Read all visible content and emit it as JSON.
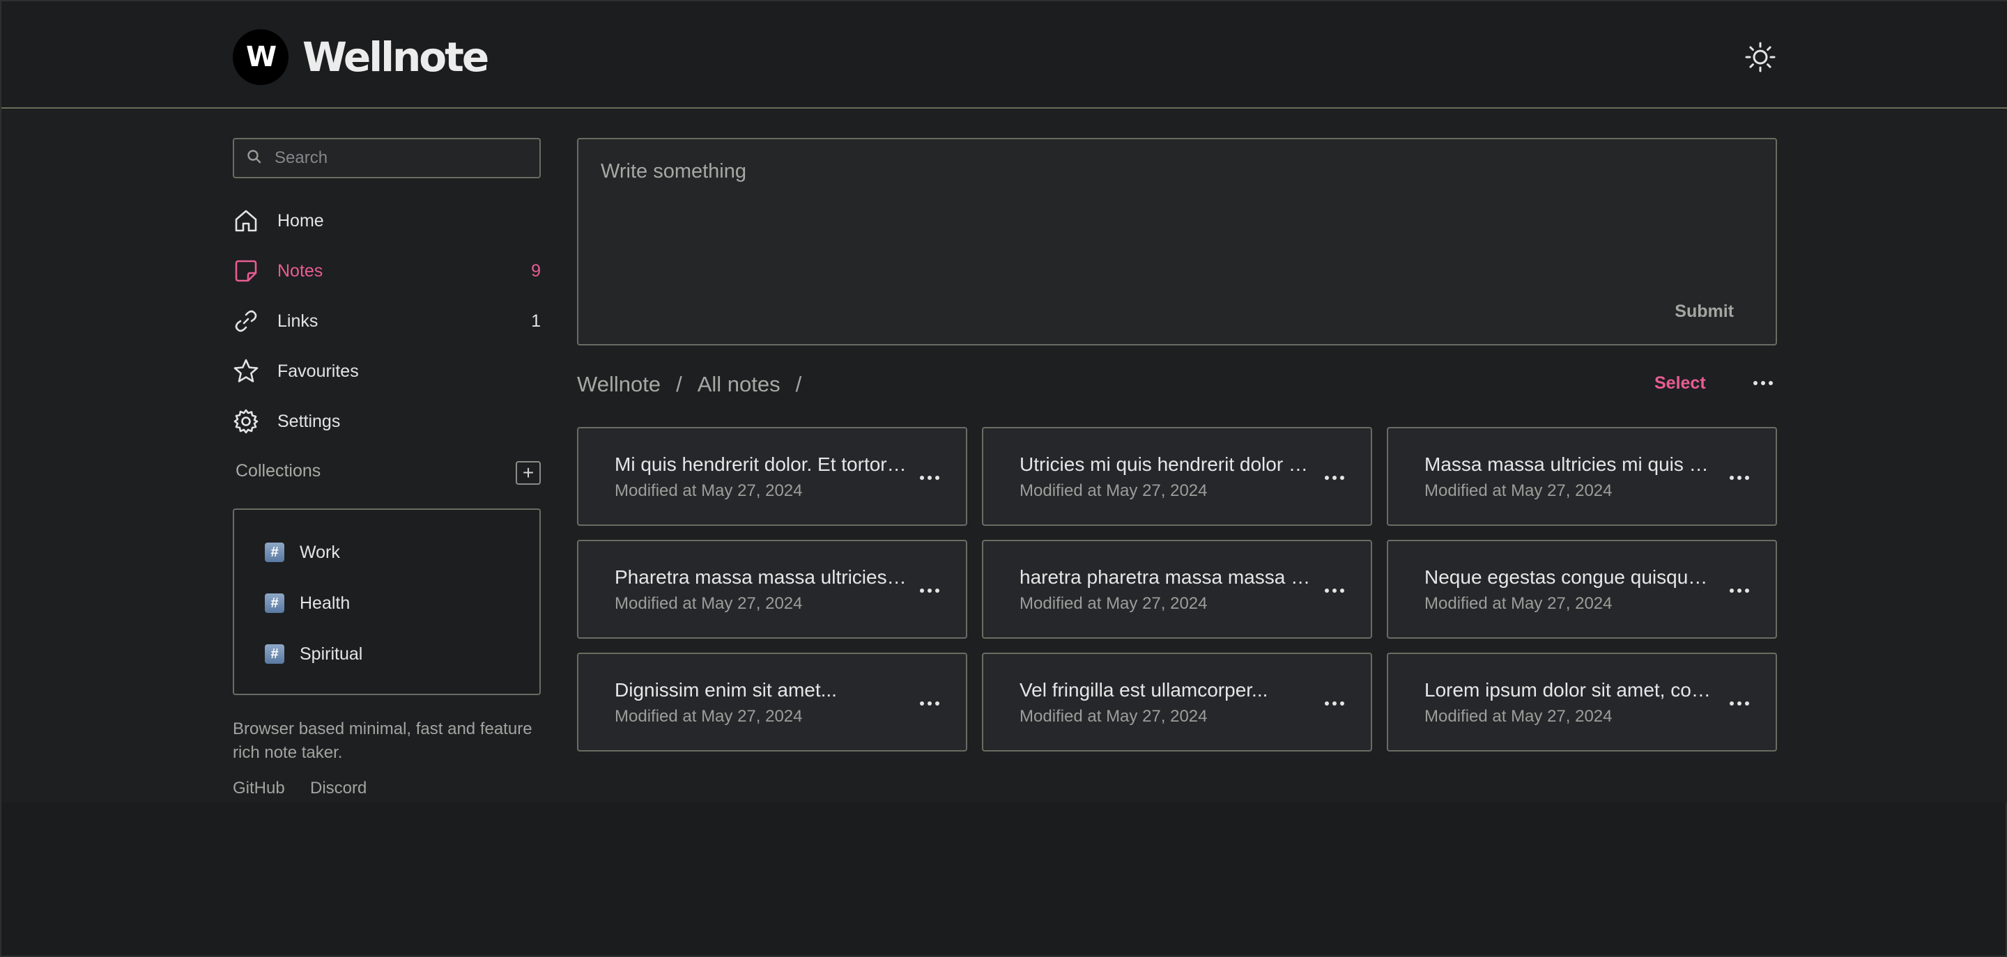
{
  "app": {
    "logo_letter": "W",
    "name": "Wellnote"
  },
  "search": {
    "placeholder": "Search"
  },
  "nav": [
    {
      "label": "Home",
      "count": "",
      "icon": "home-icon"
    },
    {
      "label": "Notes",
      "count": "9",
      "icon": "note-icon"
    },
    {
      "label": "Links",
      "count": "1",
      "icon": "link-icon"
    },
    {
      "label": "Favourites",
      "count": "",
      "icon": "star-icon"
    },
    {
      "label": "Settings",
      "count": "",
      "icon": "gear-icon"
    }
  ],
  "collections": {
    "title": "Collections",
    "add_label": "+",
    "items": [
      {
        "label": "Work",
        "icon_glyph": "#"
      },
      {
        "label": "Health",
        "icon_glyph": "#"
      },
      {
        "label": "Spiritual",
        "icon_glyph": "#"
      }
    ]
  },
  "footer": {
    "tagline": "Browser based minimal, fast and feature rich note taker.",
    "github": "GitHub",
    "discord": "Discord"
  },
  "composer": {
    "placeholder": "Write something",
    "submit": "Submit"
  },
  "breadcrumb": {
    "root": "Wellnote",
    "sep": "/",
    "current": "All notes"
  },
  "actions": {
    "select": "Select"
  },
  "notes": [
    {
      "title": "Mi quis hendrerit dolor. Et tortor consequat",
      "meta": "Modified at May 27, 2024"
    },
    {
      "title": "Utricies mi quis hendrerit dolor magna",
      "meta": "Modified at May 27, 2024"
    },
    {
      "title": "Massa massa ultricies mi quis hendrerit",
      "meta": "Modified at May 27, 2024"
    },
    {
      "title": "Pharetra massa massa ultricies mi quis",
      "meta": "Modified at May 27, 2024"
    },
    {
      "title": "haretra pharetra massa massa ultricies",
      "meta": "Modified at May 27, 2024"
    },
    {
      "title": "Neque egestas congue quisque egestas",
      "meta": "Modified at May 27, 2024"
    },
    {
      "title": "Dignissim enim sit amet...",
      "meta": "Modified at May 27, 2024"
    },
    {
      "title": "Vel fringilla est ullamcorper...",
      "meta": "Modified at May 27, 2024"
    },
    {
      "title": "Lorem ipsum dolor sit amet, consectetur",
      "meta": "Modified at May 27, 2024"
    }
  ],
  "colors": {
    "accent": "#e85d8f",
    "border": "#6a6c63",
    "background": "#1e1f21"
  }
}
